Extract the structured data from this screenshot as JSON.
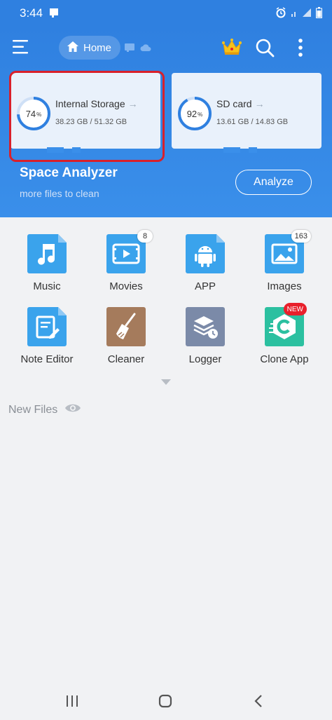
{
  "status_bar": {
    "time": "3:44",
    "icons": [
      "notification-icon",
      "alarm-icon",
      "wifi-icon",
      "signal-icon",
      "battery-icon"
    ]
  },
  "toolbar": {
    "home_label": "Home",
    "icons": [
      "menu-icon",
      "home-icon",
      "window-icon",
      "cloud-icon",
      "crown-icon",
      "search-icon",
      "more-vert-icon"
    ]
  },
  "storage": [
    {
      "name": "Internal Storage",
      "percent": 74,
      "percent_symbol": "%",
      "usage": "38.23 GB / 51.32 GB",
      "arrow": "→"
    },
    {
      "name": "SD card",
      "percent": 92,
      "percent_symbol": "%",
      "usage": "13.61 GB / 14.83 GB",
      "arrow": "→"
    }
  ],
  "analyzer": {
    "title": "Space Analyzer",
    "subtitle": "more files to clean",
    "button": "Analyze"
  },
  "categories": [
    {
      "label": "Music",
      "icon": "music-icon",
      "badge": ""
    },
    {
      "label": "Movies",
      "icon": "movie-icon",
      "badge": "8"
    },
    {
      "label": "APP",
      "icon": "android-icon",
      "badge": ""
    },
    {
      "label": "Images",
      "icon": "image-icon",
      "badge": "163"
    },
    {
      "label": "Note Editor",
      "icon": "note-editor-icon",
      "badge": ""
    },
    {
      "label": "Cleaner",
      "icon": "broom-icon",
      "badge": ""
    },
    {
      "label": "Logger",
      "icon": "logger-icon",
      "badge": ""
    },
    {
      "label": "Clone App",
      "icon": "clone-app-icon",
      "badge": "NEW"
    }
  ],
  "new_files": {
    "label": "New Files"
  },
  "colors": {
    "primary": "#2f80e0",
    "folder_blue": "#3aa3ec",
    "cleaner": "#a57b5c",
    "logger": "#7b8aa8",
    "clone": "#2cc0a0",
    "highlight": "#d8202b"
  }
}
